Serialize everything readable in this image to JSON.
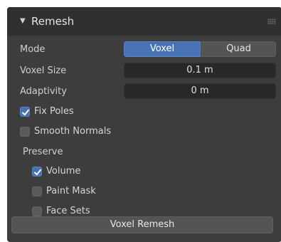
{
  "panel": {
    "title": "Remesh",
    "collapse_icon": "triangle-down"
  },
  "mode": {
    "label": "Mode",
    "options": [
      "Voxel",
      "Quad"
    ],
    "selected": "Voxel"
  },
  "voxel_size": {
    "label": "Voxel Size",
    "value": "0.1 m"
  },
  "adaptivity": {
    "label": "Adaptivity",
    "value": "0 m"
  },
  "fix_poles": {
    "label": "Fix Poles",
    "checked": true
  },
  "smooth_normals": {
    "label": "Smooth Normals",
    "checked": false
  },
  "preserve": {
    "label": "Preserve",
    "volume": {
      "label": "Volume",
      "checked": true
    },
    "paint_mask": {
      "label": "Paint Mask",
      "checked": false
    },
    "face_sets": {
      "label": "Face Sets",
      "checked": false
    }
  },
  "remesh_button": {
    "label": "Voxel Remesh"
  },
  "colors": {
    "accent": "#4772b3",
    "panel_bg": "#3d3d3d",
    "header_bg": "#303030",
    "field_bg": "#282828",
    "button_bg": "#545454"
  }
}
